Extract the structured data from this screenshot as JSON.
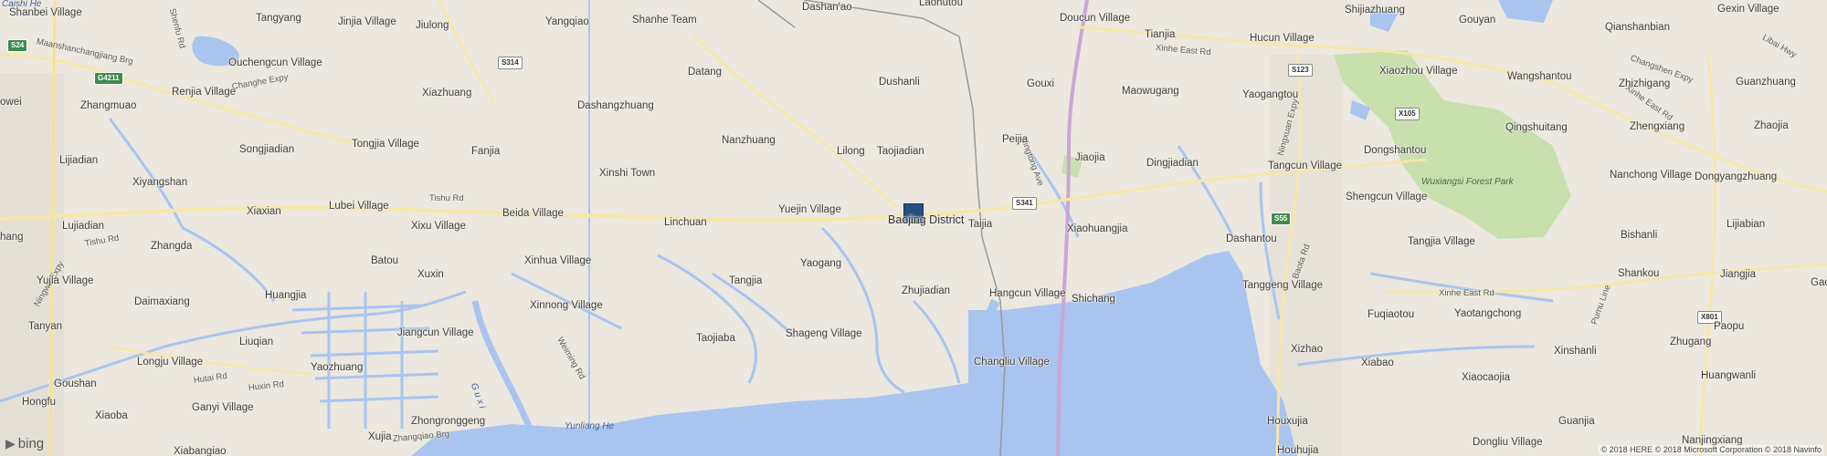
{
  "map": {
    "provider": "bing",
    "copyright": "© 2018 HERE © 2018 Microsoft Corporation © 2018 Navinfo",
    "pin": {
      "label": "Baojing District",
      "color": "#284e82"
    },
    "colors": {
      "land": "#ece8df",
      "water": "#a9c4ef",
      "park": "#c9dfae",
      "road": "#f5e7a8",
      "railway": "#c7a7d4"
    }
  },
  "places": {
    "caishi_he": "Caishi He",
    "shanbei_village": "Shanbei Village",
    "tangyang": "Tangyang",
    "jinjia_village": "Jinjia Village",
    "jiulong": "Jiulong",
    "yangqiao": "Yangqiao",
    "shanhe_team": "Shanhe Team",
    "dashan_ao": "Dashan'ao",
    "laohutou": "Laohutou",
    "doucun_village": "Doucun Village",
    "tianjia": "Tianjia",
    "hucun_village": "Hucun Village",
    "shijiazhuang": "Shijiazhuang",
    "gouyan": "Gouyan",
    "gexin_village": "Gexin Village",
    "ouchengcun_village": "Ouchengcun Village",
    "qianshanbian": "Qianshanbian",
    "maanshan_expy": "Maanshanchangjiang Brg",
    "renjia_village": "Renjia Village",
    "xiazhuang": "Xiazhuang",
    "datang": "Datang",
    "dushanli": "Dushanli",
    "gouxi": "Gouxi",
    "maowugang": "Maowugang",
    "yaogangtou": "Yaogangtou",
    "xiaozhou_village": "Xiaozhou Village",
    "wangshantou": "Wangshantou",
    "zhizhigang": "Zhizhigang",
    "guanzhuang": "Guanzhuang",
    "owei": "owei",
    "zhangmuao": "Zhangmuao",
    "dashangzhuang": "Dashangzhuang",
    "qingshuitang": "Qingshuitang",
    "zhengxiang": "Zhengxiang",
    "zhaojia": "Zhaojia",
    "lijiadian": "Lijiadian",
    "songjiadian": "Songjiadian",
    "tongjia_village": "Tongjia Village",
    "fanjia": "Fanjia",
    "nanzhuang": "Nanzhuang",
    "lilong": "Lilong",
    "taojiadian": "Taojiadian",
    "peijia": "Peijia",
    "jiaojia": "Jiaojia",
    "dingjiadian": "Dingjiadian",
    "dongshantou": "Dongshantou",
    "tangcun_village": "Tangcun Village",
    "nanchong_village": "Nanchong Village",
    "xiyangshan": "Xiyangshan",
    "xinshi_town": "Xinshi Town",
    "dongyangzhuang": "Dongyangzhuang",
    "lujiadian": "Lujiadian",
    "xiaxian": "Xiaxian",
    "lubei_village": "Lubei Village",
    "beida_village": "Beida Village",
    "xixu_village": "Xixu Village",
    "linchuan": "Linchuan",
    "yuejin_village": "Yuejin Village",
    "taijia": "Taijia",
    "xiaohuangjia": "Xiaohuangjia",
    "dashantou": "Dashantou",
    "shengcun_village": "Shengcun Village",
    "lijiabian": "Lijiabian",
    "hang": "hang",
    "zhangda": "Zhangda",
    "bishanli": "Bishanli",
    "batou": "Batou",
    "xinhua_village": "Xinhua Village",
    "yaogang": "Yaogang",
    "tangjia_village": "Tangjia Village",
    "yujia_village": "Yujia Village",
    "xuxin": "Xuxin",
    "tangjia": "Tangjia",
    "zhujiadian": "Zhujiadian",
    "hangcun_village": "Hangcun Village",
    "shichang": "Shichang",
    "tanggeng_village": "Tanggeng Village",
    "shankou": "Shankou",
    "jiangjia": "Jiangjia",
    "gao": "Gao",
    "daimaxiang": "Daimaxiang",
    "huangjia": "Huangjia",
    "xinnong_village": "Xinnong Village",
    "tanyan": "Tanyan",
    "jiangcun_village": "Jiangcun Village",
    "taojiaba": "Taojiaba",
    "shageng_village": "Shageng Village",
    "fuqiaotou": "Fuqiaotou",
    "yaotangchong": "Yaotangchong",
    "paopu": "Paopu",
    "liuqian": "Liuqian",
    "longju_village": "Longju Village",
    "yaozhuang": "Yaozhuang",
    "changliu_village": "Changliu Village",
    "xizhao": "Xizhao",
    "xinshanli": "Xinshanli",
    "zhugang": "Zhugang",
    "goushan": "Goushan",
    "xiabao": "Xiabao",
    "xiaocaojia": "Xiaocaojia",
    "huangwanli": "Huangwanli",
    "hongfu": "Hongfu",
    "xiaoba": "Xiaoba",
    "ganyi_village": "Ganyi Village",
    "zhongronggeng": "Zhongronggeng",
    "houxujia": "Houxujia",
    "guanjia": "Guanjia",
    "xujia": "Xujia",
    "xiabangiao": "Xiabangiao",
    "houhujia": "Houhujia",
    "dongliu_village": "Dongliu Village",
    "nanjingxiang": "Nanjingxiang"
  },
  "roads": {
    "s24": "S24",
    "g4211": "G4211",
    "s314": "S314",
    "s123": "S123",
    "s341": "S341",
    "s55": "S55",
    "x105": "X105",
    "x801": "X801",
    "changhe_expy": "Changhe Expy",
    "ningwu_expy": "Ningwu Expy",
    "tishu_rd_1": "Tishu Rd",
    "tishu_rd_2": "Tishu Rd",
    "xinhe_east_rd_1": "Xinhe East Rd",
    "xinhe_east_rd_2": "Xinhe East Rd",
    "xinhe_east_rd_3": "Xinhe East Rd",
    "changshen_expy": "Changshen Expy",
    "libai_hwy": "Libai Hwy",
    "ningxuan_expy": "Ningxuan Expy",
    "ningtong_ave": "Ningtong Ave",
    "baota_rd": "Baota Rd",
    "hutai_rd": "Hutai Rd",
    "huxin_rd": "Huxin Rd",
    "weiming_rd": "Weiming Rd",
    "zhangqiao_brg": "Zhangqiao Brg",
    "pumu_line": "Pumu Line",
    "shenfu_rd": "Shenfu Rd"
  },
  "water": {
    "yunliang_he": "Yunliang He",
    "gu_river": "G u x i"
  },
  "parks": {
    "wuxiangsi": "Wuxiangsi Forest Park"
  },
  "logo": {
    "text": "bing"
  }
}
